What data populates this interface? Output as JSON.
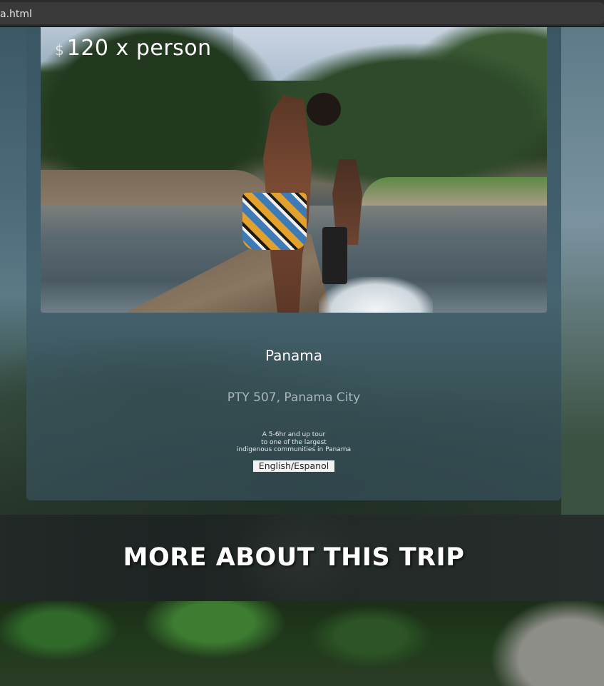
{
  "browser": {
    "tab_title": "a.html"
  },
  "card": {
    "price": {
      "currency": "$",
      "amount": "120 x person"
    },
    "photo_description": "",
    "place": "Panama",
    "address": "PTY 507, Panama City",
    "description_lines": [
      "A 5-6hr and up tour",
      "to one of the largest",
      "indigenous communities in Panama"
    ],
    "language_button": "English/Espanol"
  },
  "banner": {
    "title": "MORE ABOUT THIS TRIP"
  }
}
